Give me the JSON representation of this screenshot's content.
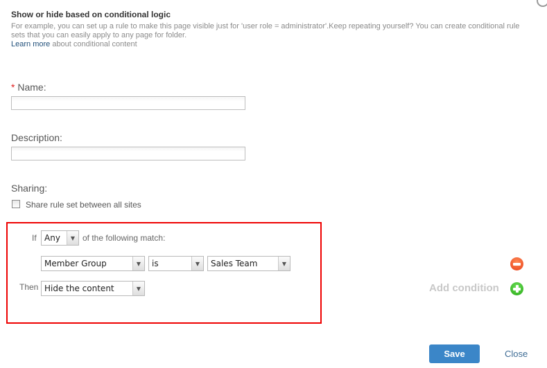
{
  "header": {
    "title": "Show or hide based on conditional logic",
    "description": "For example, you can set up a rule to make this page visible just for 'user role = administrator'.Keep repeating yourself? You can create conditional rule sets that you can easily apply to any page for folder.",
    "learn_more_link": "Learn more",
    "learn_more_suffix": " about conditional content"
  },
  "form": {
    "name": {
      "required_marker": "*",
      "label": "Name:",
      "value": ""
    },
    "description": {
      "label": "Description:",
      "value": ""
    },
    "sharing": {
      "label": "Sharing:",
      "checkbox_label": "Share rule set between all sites",
      "checked": false
    }
  },
  "rule": {
    "if_label": "If",
    "match_mode": "Any",
    "match_suffix": "of the following match:",
    "condition": {
      "field": "Member Group",
      "operator": "is",
      "value": "Sales Team"
    },
    "then_label": "Then",
    "action": "Hide the content",
    "highlight_color": "#ee0000"
  },
  "actions": {
    "add_condition_label": "Add condition",
    "remove_icon": "minus-circle-icon",
    "add_icon": "plus-circle-icon",
    "save_label": "Save",
    "close_label": "Close"
  },
  "colors": {
    "save_button": "#3b86c8",
    "remove": "#e8401a",
    "add": "#26a814"
  }
}
